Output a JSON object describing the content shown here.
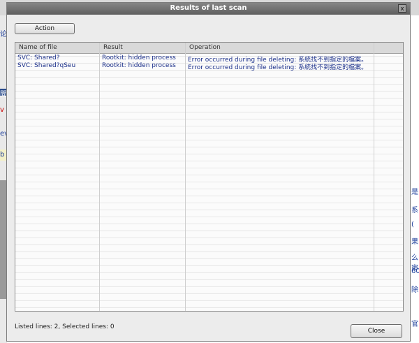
{
  "dialog": {
    "title": "Results of last scan",
    "close_glyph": "x",
    "action_label": "Action",
    "close_label": "Close",
    "status": "Listed lines: 2, Selected lines: 0"
  },
  "table": {
    "columns": [
      "Name of file",
      "Result",
      "Operation"
    ],
    "rows": [
      [
        "SVC: Shared?",
        "Rootkit: hidden process",
        "Error occurred during file deleting: 系統找不到指定的檔案。"
      ],
      [
        "SVC: Shared?qSeu",
        "Rootkit: hidden process",
        "Error occurred during file deleting: 系統找不到指定的檔案。"
      ]
    ]
  },
  "background": {
    "left_chars": [
      "论",
      "聞",
      "v",
      "ev",
      "b"
    ],
    "right_chars": [
      "是",
      "系",
      "(",
      "果",
      "么审",
      "60",
      "除",
      "官"
    ]
  }
}
